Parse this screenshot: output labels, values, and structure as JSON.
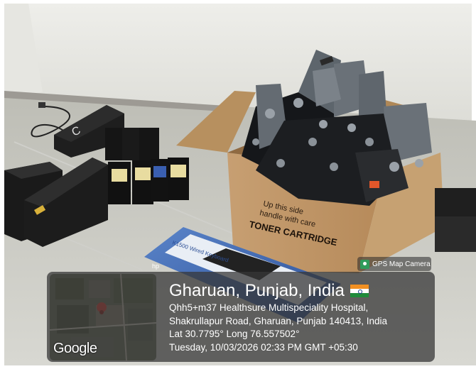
{
  "badge": {
    "label": "GPS Map Camera",
    "icon": "gps-map-camera-icon"
  },
  "overlay": {
    "title": "Gharuan, Punjab, India",
    "flag_icon": "india-flag-icon",
    "address_line1": "Qhh5+m37 Healthsure Multispeciality Hospital,",
    "address_line2": "Shakrullapur Road, Gharuan, Punjab 140413, India",
    "coordinates": "Lat 30.7795° Long 76.557502°",
    "timestamp": "Tuesday, 10/03/2026 02:33 PM GMT +05:30",
    "map_logo": "Google"
  },
  "scene": {
    "box_print_line1": "Up this side",
    "box_print_line2": "handle with care",
    "box_print_line3": "TONER CARTRIDGE",
    "keyboard_box_text": "K1500 Wired Keyboard",
    "keyboard_brand": "hp",
    "charger_mark": "C"
  },
  "colors": {
    "accent_pin": "#e23b2e",
    "flag_saffron": "#f29022",
    "flag_green": "#1f8b3b"
  }
}
